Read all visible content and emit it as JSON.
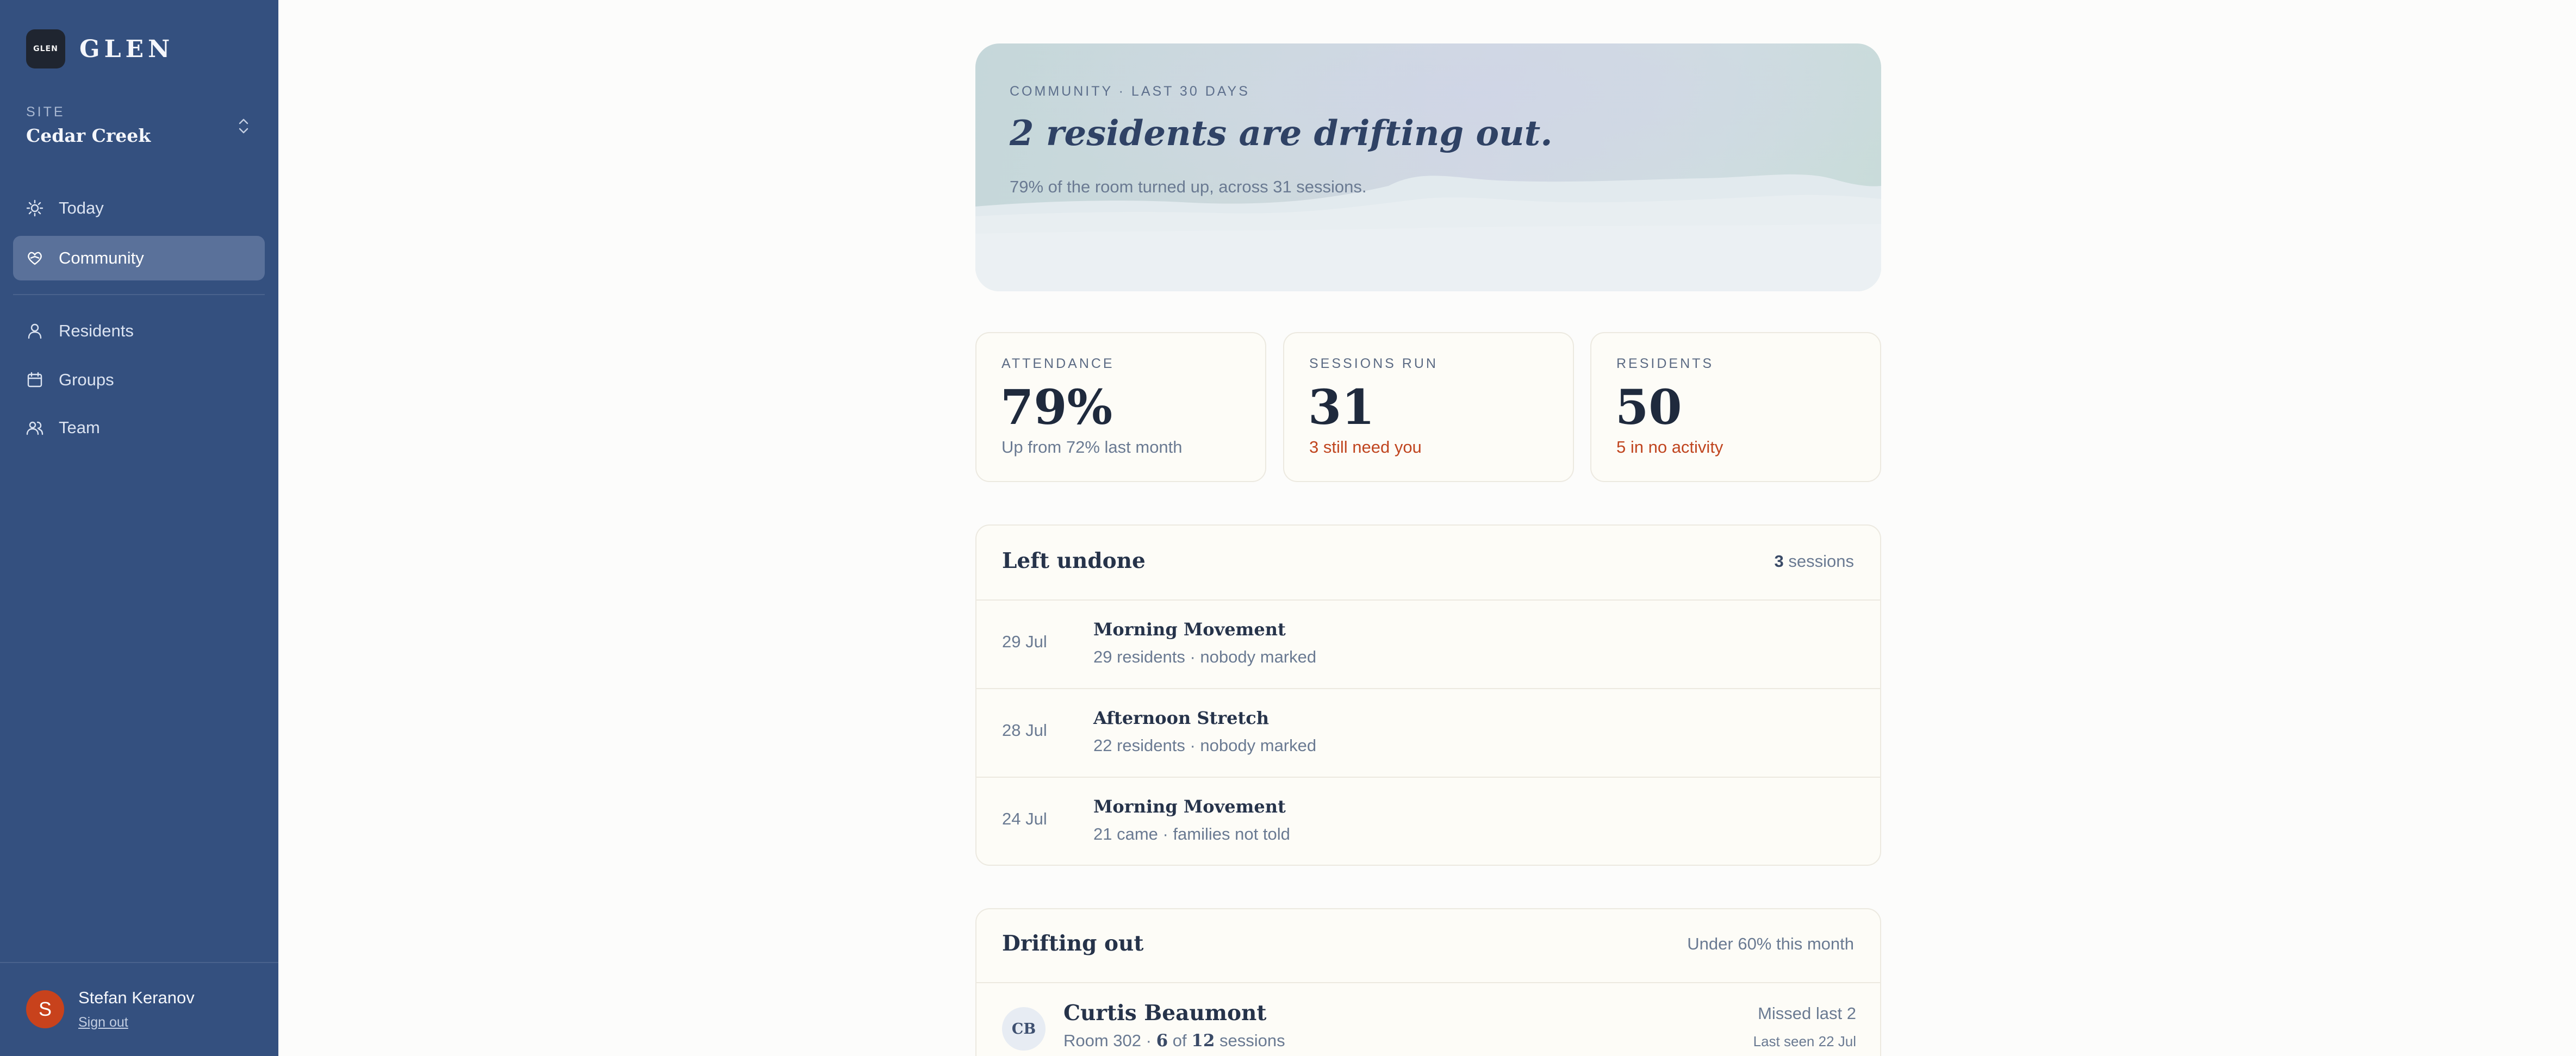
{
  "app": {
    "name": "GLEN",
    "logo_text": "GLEN"
  },
  "site": {
    "label": "SITE",
    "name": "Cedar Creek"
  },
  "nav": {
    "primary": [
      {
        "label": "Today",
        "icon": "sun-icon"
      },
      {
        "label": "Community",
        "icon": "heart-hands-icon",
        "active": true
      }
    ],
    "secondary": [
      {
        "label": "Residents",
        "icon": "person-icon"
      },
      {
        "label": "Groups",
        "icon": "calendar-icon"
      },
      {
        "label": "Team",
        "icon": "people-icon"
      }
    ]
  },
  "user": {
    "initial": "S",
    "name": "Stefan Keranov",
    "sign_out": "Sign out"
  },
  "hero": {
    "eyebrow": "COMMUNITY · LAST 30 DAYS",
    "title": "2 residents are drifting out.",
    "subtitle": "79% of the room turned up, across 31 sessions."
  },
  "stats": [
    {
      "label": "ATTENDANCE",
      "value": "79%",
      "note": "Up from 72% last month",
      "note_color": "#6a7a92"
    },
    {
      "label": "SESSIONS RUN",
      "value": "31",
      "note": "3 still need you",
      "note_color": "#c0451f"
    },
    {
      "label": "RESIDENTS",
      "value": "50",
      "note": "5 in no activity",
      "note_color": "#c0451f"
    }
  ],
  "left_undone": {
    "title": "Left undone",
    "count": "3",
    "count_suffix": " sessions",
    "rows": [
      {
        "date": "29 Jul",
        "title": "Morning Movement",
        "sub": "29 residents · nobody marked"
      },
      {
        "date": "28 Jul",
        "title": "Afternoon Stretch",
        "sub": "22 residents · nobody marked"
      },
      {
        "date": "24 Jul",
        "title": "Morning Movement",
        "sub": "21 came · families not told"
      }
    ]
  },
  "drifting_out": {
    "title": "Drifting out",
    "meta": "Under 60% this month",
    "rows": [
      {
        "initials": "CB",
        "name": "Curtis Beaumont",
        "room": "Room 302 · ",
        "attended": "6",
        "of_text": " of ",
        "total": "12",
        "sessions_text": " sessions",
        "missed": "Missed last 2",
        "last_seen": "Last seen 22 Jul"
      }
    ]
  },
  "colors": {
    "sidebar": "#34507f",
    "active_nav": "#5a719a",
    "accent_warn": "#c0451f",
    "avatar": "#c8421c"
  }
}
